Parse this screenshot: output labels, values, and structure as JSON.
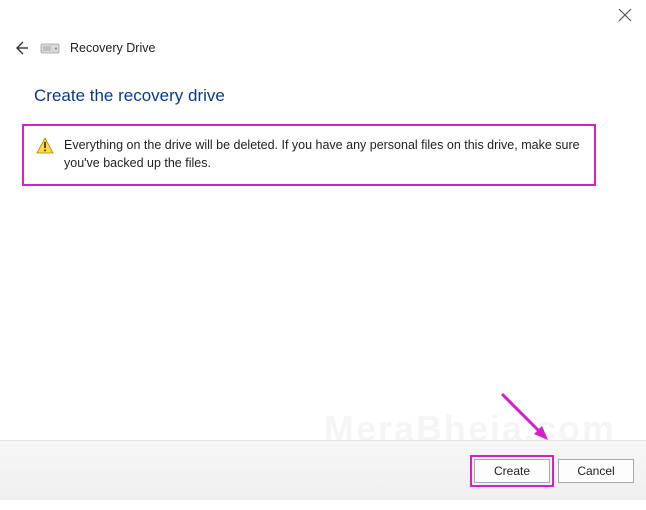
{
  "titlebar": {
    "close_label": "Close"
  },
  "header": {
    "back_label": "Back",
    "drive_label": "Recovery Drive icon",
    "title": "Recovery Drive"
  },
  "main": {
    "heading": "Create the recovery drive"
  },
  "warning": {
    "icon_label": "Warning",
    "text": "Everything on the drive will be deleted. If you have any personal files on this drive, make sure you've backed up the files."
  },
  "footer": {
    "create_label": "Create",
    "cancel_label": "Cancel"
  },
  "accent_color": "#d420c8"
}
